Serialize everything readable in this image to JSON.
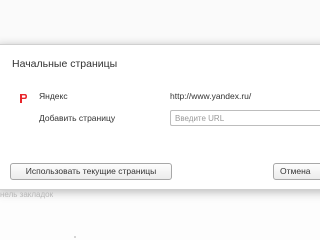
{
  "dialog": {
    "title": "Начальные страницы",
    "pages": [
      {
        "name": "Яндекс",
        "url": "http://www.yandex.ru/",
        "icon": "yandex-favicon-icon"
      }
    ],
    "add_page_label": "Добавить страницу",
    "url_input": {
      "value": "",
      "placeholder": "Введите URL"
    },
    "use_current_button": "Использовать текущие страницы",
    "cancel_button": "Отмена"
  },
  "background": {
    "bookmarks_bar_fragment": "нель закладок"
  },
  "colors": {
    "favicon_red": "#e8262b",
    "dialog_border": "#d0d0d0",
    "muted_text": "#b8b8b8"
  }
}
